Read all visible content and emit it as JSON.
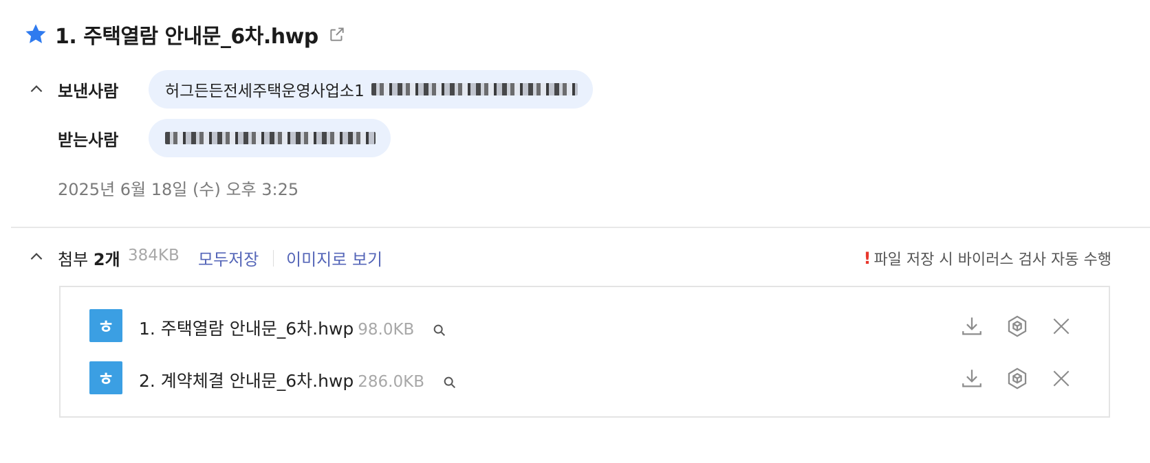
{
  "mail": {
    "subject": "1. 주택열람 안내문_6차.hwp",
    "sender_label": "보낸사람",
    "sender_name": "허그든든전세주택운영사업소1",
    "recipient_label": "받는사람",
    "date": "2025년 6월 18일 (수) 오후 3:25"
  },
  "attachments": {
    "label_prefix": "첨부",
    "count": "2개",
    "total_size": "384KB",
    "save_all": "모두저장",
    "view_images": "이미지로 보기",
    "virus_mark": "!",
    "virus_note": "파일 저장 시 바이러스 검사 자동 수행",
    "files": [
      {
        "icon_letter": "ㅎ",
        "name": "1. 주택열람 안내문_6차.hwp",
        "size": "98.0KB"
      },
      {
        "icon_letter": "ㅎ",
        "name": "2. 계약체결 안내문_6차.hwp",
        "size": "286.0KB"
      }
    ]
  },
  "colors": {
    "accent_link": "#5566b8",
    "star": "#2f7bef",
    "chip_bg": "#eaf1fd",
    "hwp_icon": "#3b9fe3",
    "warning": "#e8372c"
  },
  "icons": [
    "star-icon",
    "popout-icon",
    "chevron-up-icon",
    "search-icon",
    "download-icon",
    "cube-icon",
    "close-icon"
  ]
}
